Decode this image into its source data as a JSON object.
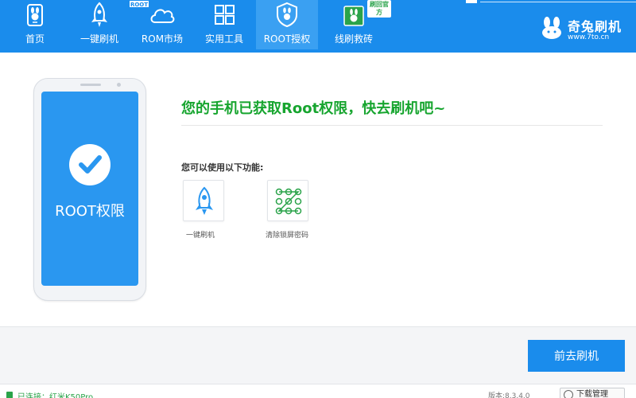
{
  "nav": {
    "items": [
      {
        "label": "首页",
        "icon": "home-rabbit-icon"
      },
      {
        "label": "一键刷机",
        "icon": "rocket-icon"
      },
      {
        "label": "ROM市场",
        "icon": "cloud-icon"
      },
      {
        "label": "实用工具",
        "icon": "grid-icon"
      },
      {
        "label": "ROOT授权",
        "icon": "shield-rabbit-icon"
      },
      {
        "label": "线刷救砖",
        "icon": "rabbit-box-icon"
      }
    ],
    "active_index": 4,
    "badge_rom": "ROOT",
    "badge_flash": "刷回官方"
  },
  "brand": {
    "name": "奇兔刷机",
    "url": "www.7to.cn"
  },
  "phone": {
    "screen_text": "ROOT权限"
  },
  "main": {
    "headline": "您的手机已获取Root权限，快去刷机吧~",
    "subtitle": "您可以使用以下功能:",
    "features": [
      {
        "label": "一键刷机",
        "icon": "rocket-icon"
      },
      {
        "label": "清除锁屏密码",
        "icon": "pattern-lock-icon"
      }
    ]
  },
  "action": {
    "button_label": "前去刷机"
  },
  "status": {
    "connected_text": "已连接：红米K50Pro",
    "version": "版本:8.3.4.0",
    "download_label": "下载管理"
  },
  "colors": {
    "primary": "#1a8cec",
    "active_tab": "#3aa0f2",
    "success": "#17a52f",
    "phone_screen": "#2a97f0"
  }
}
